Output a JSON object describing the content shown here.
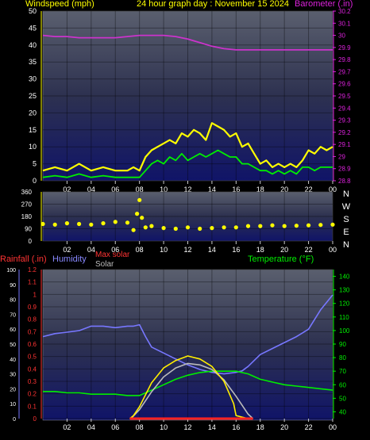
{
  "chart_data": [
    {
      "type": "line",
      "title": "24 hour graph day : November 15 2024",
      "left_axis_label": "Windspeed (mph)",
      "right_axis_label": "Barometer (.in)",
      "left_ylim": [
        0,
        50
      ],
      "left_ticks": [
        "0",
        "5",
        "10",
        "15",
        "20",
        "25",
        "30",
        "35",
        "40",
        "45",
        "50"
      ],
      "right_ylim": [
        28.8,
        30.2
      ],
      "right_ticks": [
        "28.8",
        "28.9",
        "29",
        "29.1",
        "29.2",
        "29.3",
        "29.4",
        "29.5",
        "29.6",
        "29.7",
        "29.8",
        "29.9",
        "30",
        "30.1",
        "30.2"
      ],
      "x_tick_labels": [
        "02",
        "04",
        "06",
        "08",
        "10",
        "12",
        "14",
        "16",
        "18",
        "20",
        "22",
        "00"
      ],
      "x_ticks": [
        2,
        4,
        6,
        8,
        10,
        12,
        14,
        16,
        18,
        20,
        22,
        24
      ],
      "xlim": [
        0,
        24
      ],
      "grid": true,
      "series": [
        {
          "name": "Barometer",
          "axis": "right",
          "color": "#cc33cc",
          "x": [
            0,
            1,
            2,
            3,
            4,
            5,
            6,
            7,
            8,
            9,
            10,
            11,
            12,
            13,
            14,
            15,
            16,
            17,
            18,
            19,
            20,
            21,
            22,
            23,
            24
          ],
          "y": [
            30.0,
            29.99,
            29.99,
            29.98,
            29.98,
            29.98,
            29.98,
            29.99,
            30.0,
            30.0,
            30.0,
            29.99,
            29.97,
            29.94,
            29.91,
            29.89,
            29.88,
            29.88,
            29.88,
            29.88,
            29.88,
            29.88,
            29.88,
            29.88,
            29.88
          ]
        },
        {
          "name": "Wind gust",
          "axis": "left",
          "color": "#ffff00",
          "x": [
            0,
            1,
            2,
            3,
            4,
            5,
            6,
            7,
            7.5,
            8,
            8.5,
            9,
            9.5,
            10,
            10.5,
            11,
            11.5,
            12,
            12.5,
            13,
            13.5,
            14,
            14.5,
            15,
            15.5,
            16,
            16.5,
            17,
            17.5,
            18,
            18.5,
            19,
            19.5,
            20,
            20.5,
            21,
            21.5,
            22,
            22.5,
            23,
            23.5,
            24
          ],
          "y": [
            3,
            4,
            3,
            5,
            3,
            4,
            3,
            3,
            4,
            3,
            7,
            9,
            10,
            11,
            12,
            11,
            14,
            13,
            15,
            14,
            12,
            17,
            16,
            15,
            13,
            14,
            10,
            11,
            8,
            5,
            6,
            4,
            5,
            4,
            5,
            4,
            6,
            9,
            8,
            10,
            9,
            10
          ]
        },
        {
          "name": "Wind speed",
          "axis": "left",
          "color": "#00ee00",
          "x": [
            0,
            1,
            2,
            3,
            4,
            5,
            6,
            7,
            7.5,
            8,
            8.5,
            9,
            9.5,
            10,
            10.5,
            11,
            11.5,
            12,
            12.5,
            13,
            13.5,
            14,
            14.5,
            15,
            15.5,
            16,
            16.5,
            17,
            17.5,
            18,
            18.5,
            19,
            19.5,
            20,
            20.5,
            21,
            21.5,
            22,
            22.5,
            23,
            23.5,
            24
          ],
          "y": [
            1,
            1.5,
            1,
            2,
            1,
            1.5,
            1,
            1,
            1,
            1,
            3,
            5,
            6,
            5,
            7,
            6,
            8,
            6,
            7,
            8,
            7,
            8,
            9,
            8,
            7,
            7,
            5,
            5,
            4,
            3,
            3,
            2,
            3,
            2,
            3,
            2,
            4,
            4,
            3,
            4,
            4,
            4
          ]
        }
      ]
    },
    {
      "type": "scatter",
      "title": "",
      "ylim": [
        0,
        360
      ],
      "y_ticks": [
        "0",
        "90",
        "180",
        "270",
        "360"
      ],
      "direction_labels": [
        "N",
        "W",
        "S",
        "E",
        "N"
      ],
      "x_tick_labels": [
        "02",
        "04",
        "06",
        "08",
        "10",
        "12",
        "14",
        "16",
        "18",
        "20",
        "22",
        "00"
      ],
      "xlim": [
        0,
        24
      ],
      "series": [
        {
          "name": "Wind direction",
          "color": "#ffff00",
          "x": [
            0,
            1,
            2,
            3,
            4,
            5,
            6,
            7,
            7.5,
            7.8,
            8,
            8.2,
            8.5,
            9,
            10,
            11,
            12,
            13,
            14,
            15,
            16,
            17,
            18,
            19,
            20,
            21,
            22,
            23,
            24
          ],
          "y": [
            125,
            120,
            130,
            125,
            120,
            130,
            140,
            135,
            80,
            200,
            300,
            170,
            100,
            110,
            95,
            90,
            100,
            90,
            95,
            100,
            100,
            110,
            110,
            115,
            110,
            112,
            115,
            118,
            120
          ]
        }
      ]
    },
    {
      "type": "line",
      "title": "",
      "labels": {
        "rainfall": "Rainfall (.in)",
        "humidity": "Humidity",
        "max_solar": "Max solar",
        "solar": "Solar",
        "temperature": "Temperature (°F)"
      },
      "humidity_ylim": [
        0,
        100
      ],
      "humidity_ticks": [
        "0",
        "10",
        "20",
        "30",
        "40",
        "50",
        "60",
        "70",
        "80",
        "90",
        "100"
      ],
      "rain_ylim": [
        0,
        1.2
      ],
      "rain_ticks": [
        "0",
        "0.1",
        "0.2",
        "0.3",
        "0.4",
        "0.5",
        "0.6",
        "0.7",
        "0.8",
        "0.9",
        "1",
        "1.1",
        "1.2"
      ],
      "temp_ylim": [
        35,
        145
      ],
      "temp_ticks": [
        "40",
        "50",
        "60",
        "70",
        "80",
        "90",
        "100",
        "110",
        "120",
        "130",
        "140"
      ],
      "x_tick_labels": [
        "02",
        "04",
        "06",
        "08",
        "10",
        "12",
        "14",
        "16",
        "18",
        "20",
        "22",
        "00"
      ],
      "xlim": [
        0,
        24
      ],
      "series": [
        {
          "name": "Humidity",
          "axis": "humidity",
          "color": "#7777ff",
          "x": [
            0,
            1,
            2,
            3,
            4,
            5,
            6,
            7,
            7.5,
            8,
            8.5,
            9,
            10,
            11,
            12,
            13,
            14,
            15,
            16,
            16.5,
            17,
            18,
            19,
            20,
            21,
            22,
            23,
            24
          ],
          "y": [
            55,
            57,
            58,
            59,
            62,
            62,
            61,
            62,
            62,
            63,
            55,
            48,
            44,
            40,
            36,
            33,
            31,
            30,
            31,
            32,
            35,
            43,
            47,
            51,
            55,
            60,
            73,
            83
          ]
        },
        {
          "name": "Temperature",
          "axis": "temp",
          "color": "#00ee00",
          "x": [
            0,
            1,
            2,
            3,
            4,
            5,
            6,
            7,
            7.5,
            8,
            9,
            10,
            11,
            12,
            13,
            14,
            15,
            16,
            17,
            18,
            19,
            20,
            21,
            22,
            23,
            24
          ],
          "y": [
            55,
            55,
            54,
            54,
            53,
            53,
            53,
            52,
            52,
            52,
            56,
            60,
            64,
            67,
            69,
            70,
            70,
            70,
            68,
            64,
            62,
            60,
            59,
            58,
            57,
            56
          ]
        },
        {
          "name": "Max solar",
          "axis": "humidity",
          "color": "#bbbbbb",
          "x": [
            7.3,
            8,
            9,
            10,
            11,
            12,
            13,
            14,
            15,
            16,
            17,
            17.4
          ],
          "y": [
            0,
            6,
            18,
            28,
            34,
            37,
            36,
            33,
            26,
            15,
            3,
            0
          ]
        },
        {
          "name": "Solar",
          "axis": "humidity",
          "color": "#ffee00",
          "x": [
            7.2,
            7.5,
            8,
            9,
            10,
            11,
            12,
            13,
            14,
            15,
            15.8,
            16,
            16.5,
            17
          ],
          "y": [
            0,
            2,
            8,
            24,
            34,
            39,
            42,
            40,
            35,
            25,
            10,
            2,
            1,
            0
          ]
        },
        {
          "name": "Rainfall",
          "axis": "rain",
          "color": "#ff2222",
          "x": [
            7.2,
            17.4
          ],
          "y": [
            0,
            0
          ]
        }
      ]
    }
  ]
}
